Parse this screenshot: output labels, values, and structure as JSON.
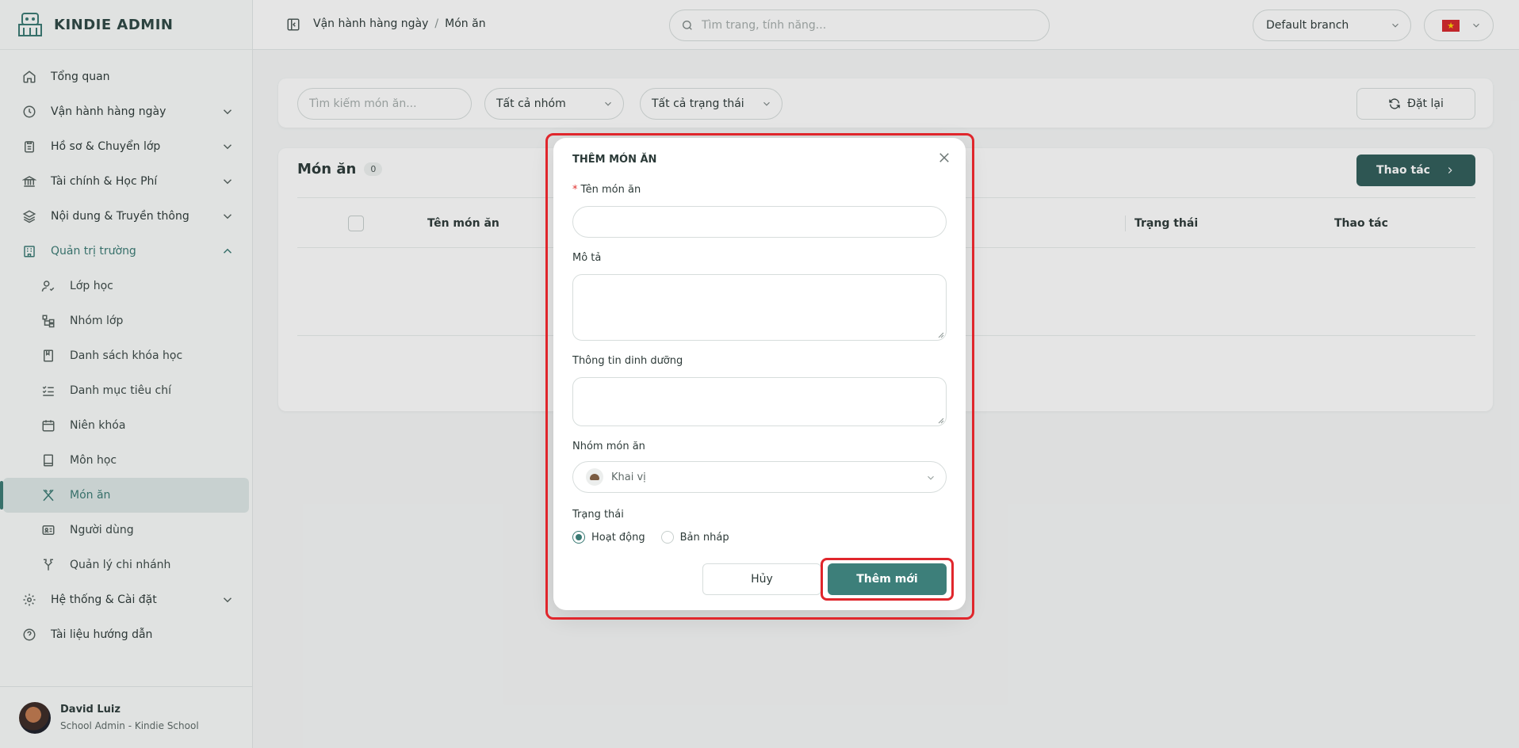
{
  "app": {
    "name": "KINDIE ADMIN"
  },
  "sidebar": {
    "items": [
      {
        "label": "Tổng quan",
        "icon": "home-icon"
      },
      {
        "label": "Vận hành hàng ngày",
        "icon": "clock-icon"
      },
      {
        "label": "Hồ sơ & Chuyển lớp",
        "icon": "clipboard-icon"
      },
      {
        "label": "Tài chính & Học Phí",
        "icon": "bank-icon"
      },
      {
        "label": "Nội dung & Truyền thông",
        "icon": "layers-icon"
      },
      {
        "label": "Quản trị trường",
        "icon": "building-icon"
      }
    ],
    "sub_items": [
      {
        "label": "Lớp học",
        "icon": "user-check-icon"
      },
      {
        "label": "Nhóm lớp",
        "icon": "tree-icon"
      },
      {
        "label": "Danh sách khóa học",
        "icon": "bookmark-icon"
      },
      {
        "label": "Danh mục tiêu chí",
        "icon": "checklist-icon"
      },
      {
        "label": "Niên khóa",
        "icon": "calendar-icon"
      },
      {
        "label": "Môn học",
        "icon": "book-icon"
      },
      {
        "label": "Món ăn",
        "icon": "utensils-icon"
      },
      {
        "label": "Người dùng",
        "icon": "id-card-icon"
      },
      {
        "label": "Quản lý chi nhánh",
        "icon": "split-icon"
      }
    ],
    "bottom_items": [
      {
        "label": "Hệ thống & Cài đặt",
        "icon": "gear-icon"
      },
      {
        "label": "Tài liệu hướng dẫn",
        "icon": "help-icon"
      }
    ],
    "user": {
      "name": "David Luiz",
      "role": "School Admin - Kindie School"
    }
  },
  "header": {
    "breadcrumb": [
      "Vận hành hàng ngày",
      "Món ăn"
    ],
    "breadcrumb_sep": "/",
    "search_placeholder": "Tìm trang, tính năng...",
    "branch": "Default branch"
  },
  "filters": {
    "search_placeholder": "Tìm kiếm món ăn...",
    "group": "Tất cả nhóm",
    "status": "Tất cả trạng thái",
    "reset": "Đặt lại"
  },
  "list": {
    "title": "Món ăn",
    "count": "0",
    "action": "Thao tác",
    "columns": [
      "Tên món ăn",
      "Trạng thái",
      "Thao tác"
    ]
  },
  "modal": {
    "title": "THÊM MÓN ĂN",
    "required_mark": "*",
    "name_label": "Tên món ăn",
    "desc_label": "Mô tả",
    "nutrition_label": "Thông tin dinh dưỡng",
    "group_label": "Nhóm món ăn",
    "group_value": "Khai vị",
    "status_label": "Trạng thái",
    "status_options": [
      "Hoạt động",
      "Bản nháp"
    ],
    "cancel": "Hủy",
    "submit": "Thêm mới"
  },
  "colors": {
    "primary": "#3d7f7a",
    "primary_dark": "#2f5d59",
    "highlight": "#e0262c"
  }
}
